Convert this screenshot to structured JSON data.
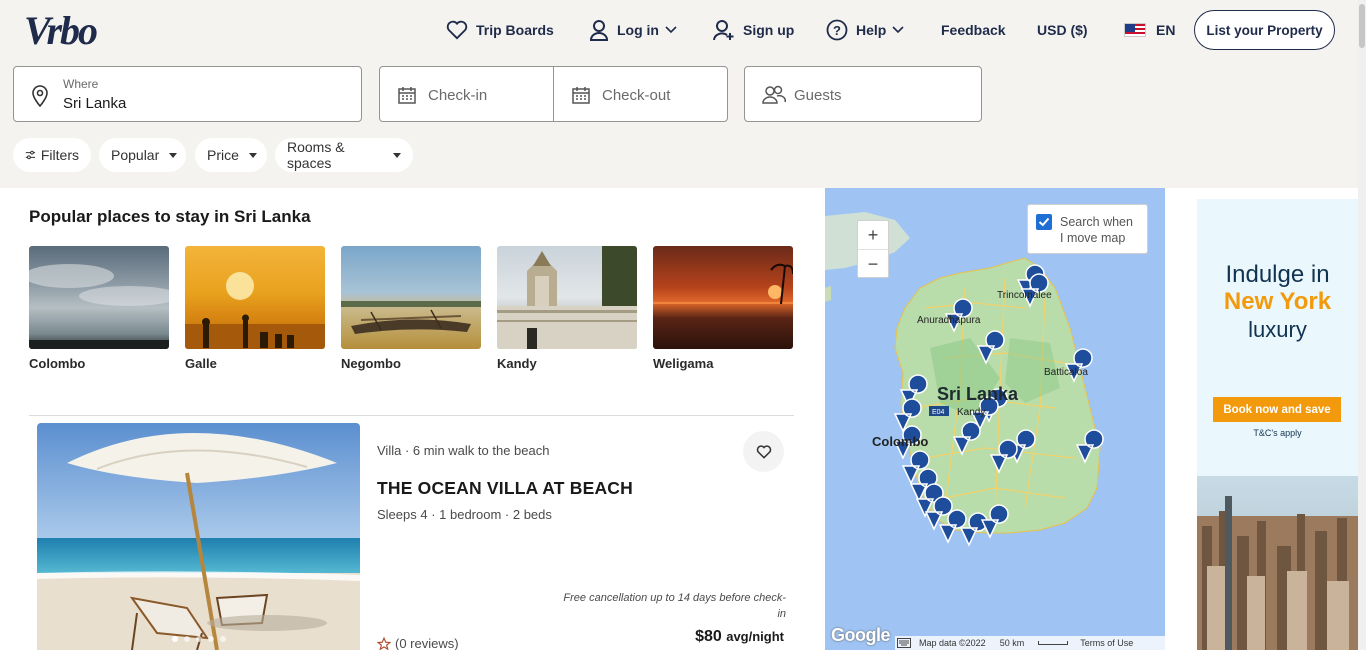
{
  "brand": {
    "logo_text": "Vrbo"
  },
  "nav": {
    "trip_boards": "Trip Boards",
    "log_in": "Log in",
    "sign_up": "Sign up",
    "help": "Help",
    "feedback": "Feedback",
    "currency": "USD ($)",
    "language": "EN",
    "list_property": "List your Property"
  },
  "search": {
    "where_label": "Where",
    "where_value": "Sri Lanka",
    "checkin_placeholder": "Check-in",
    "checkout_placeholder": "Check-out",
    "guests_placeholder": "Guests"
  },
  "filters": [
    {
      "label": "Filters"
    },
    {
      "label": "Popular"
    },
    {
      "label": "Price"
    },
    {
      "label": "Rooms & spaces"
    }
  ],
  "popular": {
    "title": "Popular places to stay in Sri Lanka",
    "places": [
      "Colombo",
      "Galle",
      "Negombo",
      "Kandy",
      "Weligama"
    ]
  },
  "listing": {
    "type": "Villa · 6 min walk to the beach",
    "name": "THE OCEAN VILLA AT BEACH",
    "sleeps": "Sleeps 4 · 1 bedroom · 2 beds",
    "cancellation": "Free cancellation up to 14 days before check-in",
    "reviews": "(0 reviews)",
    "price": "$80",
    "price_unit": "avg/night",
    "photo_count": 5,
    "photo_index": 1
  },
  "map": {
    "search_when_1": "Search when",
    "search_when_2": "I move map",
    "search_when_checked": true,
    "zoom_in": "+",
    "zoom_out": "−",
    "country_label": "Sri Lanka",
    "city_labels": [
      "Trincomalee",
      "Anuradhapura",
      "Batticaloa",
      "Colombo",
      "Kandy"
    ],
    "road_label": "E04",
    "google": "Google",
    "map_data": "Map data ©2022",
    "scale": "50 km",
    "terms": "Terms of Use",
    "pin_color": "#1e4d9b"
  },
  "ad": {
    "line1": "Indulge in",
    "line2": "New York",
    "line3": "luxury",
    "button": "Book now and save",
    "terms": "T&C's apply"
  },
  "colors": {
    "brand_navy": "#1f2b4a",
    "accent_orange": "#f39a0c",
    "header_bg": "#f5f3f0"
  }
}
